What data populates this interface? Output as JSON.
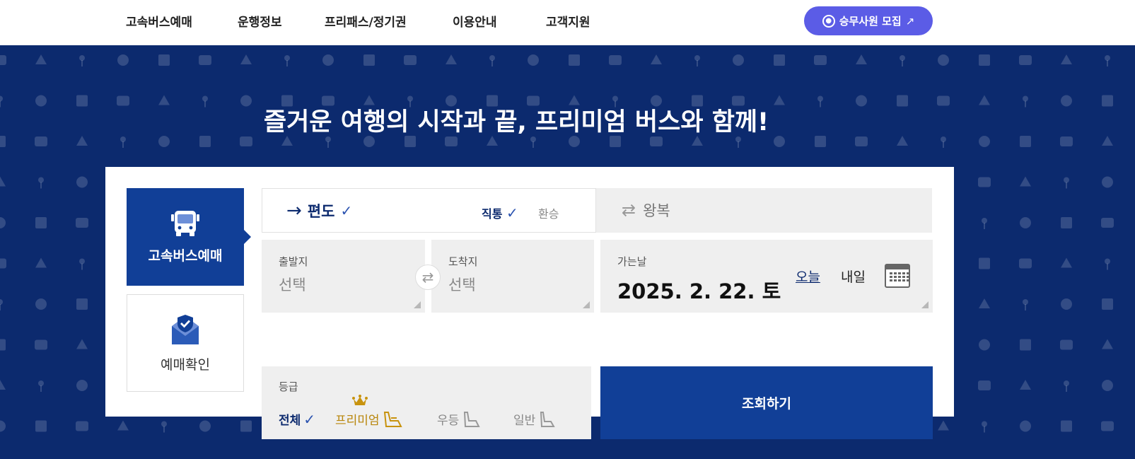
{
  "nav": {
    "items": [
      "고속버스예매",
      "운행정보",
      "프리패스/정기권",
      "이용안내",
      "고객지원"
    ],
    "recruit_label": "승무사원 모집",
    "recruit_arrow": "↗"
  },
  "hero": {
    "title": "즐거운 여행의 시작과 끝, 프리미엄 버스와 함께!"
  },
  "side_tabs": {
    "booking": "고속버스예매",
    "check": "예매확인"
  },
  "trip": {
    "oneway_arrow": "→",
    "oneway": "편도",
    "check_mark": "✓",
    "direct": "직통",
    "transfer": "환승",
    "round_icon": "⇄",
    "roundtrip": "왕복"
  },
  "fields": {
    "departure_label": "출발지",
    "departure_value": "선택",
    "arrival_label": "도착지",
    "arrival_value": "선택",
    "swap_icon": "⇄",
    "date_label": "가는날",
    "date_value": "2025. 2. 22. 토",
    "today": "오늘",
    "tomorrow": "내일"
  },
  "grade": {
    "label": "등급",
    "options": [
      "전체",
      "프리미엄",
      "우등",
      "일반"
    ],
    "selected": "전체"
  },
  "search_label": "조회하기",
  "colors": {
    "primary": "#113f97",
    "hero_bg": "#0c2a6e",
    "recruit": "#5b5ce6",
    "premium": "#b8860b"
  }
}
